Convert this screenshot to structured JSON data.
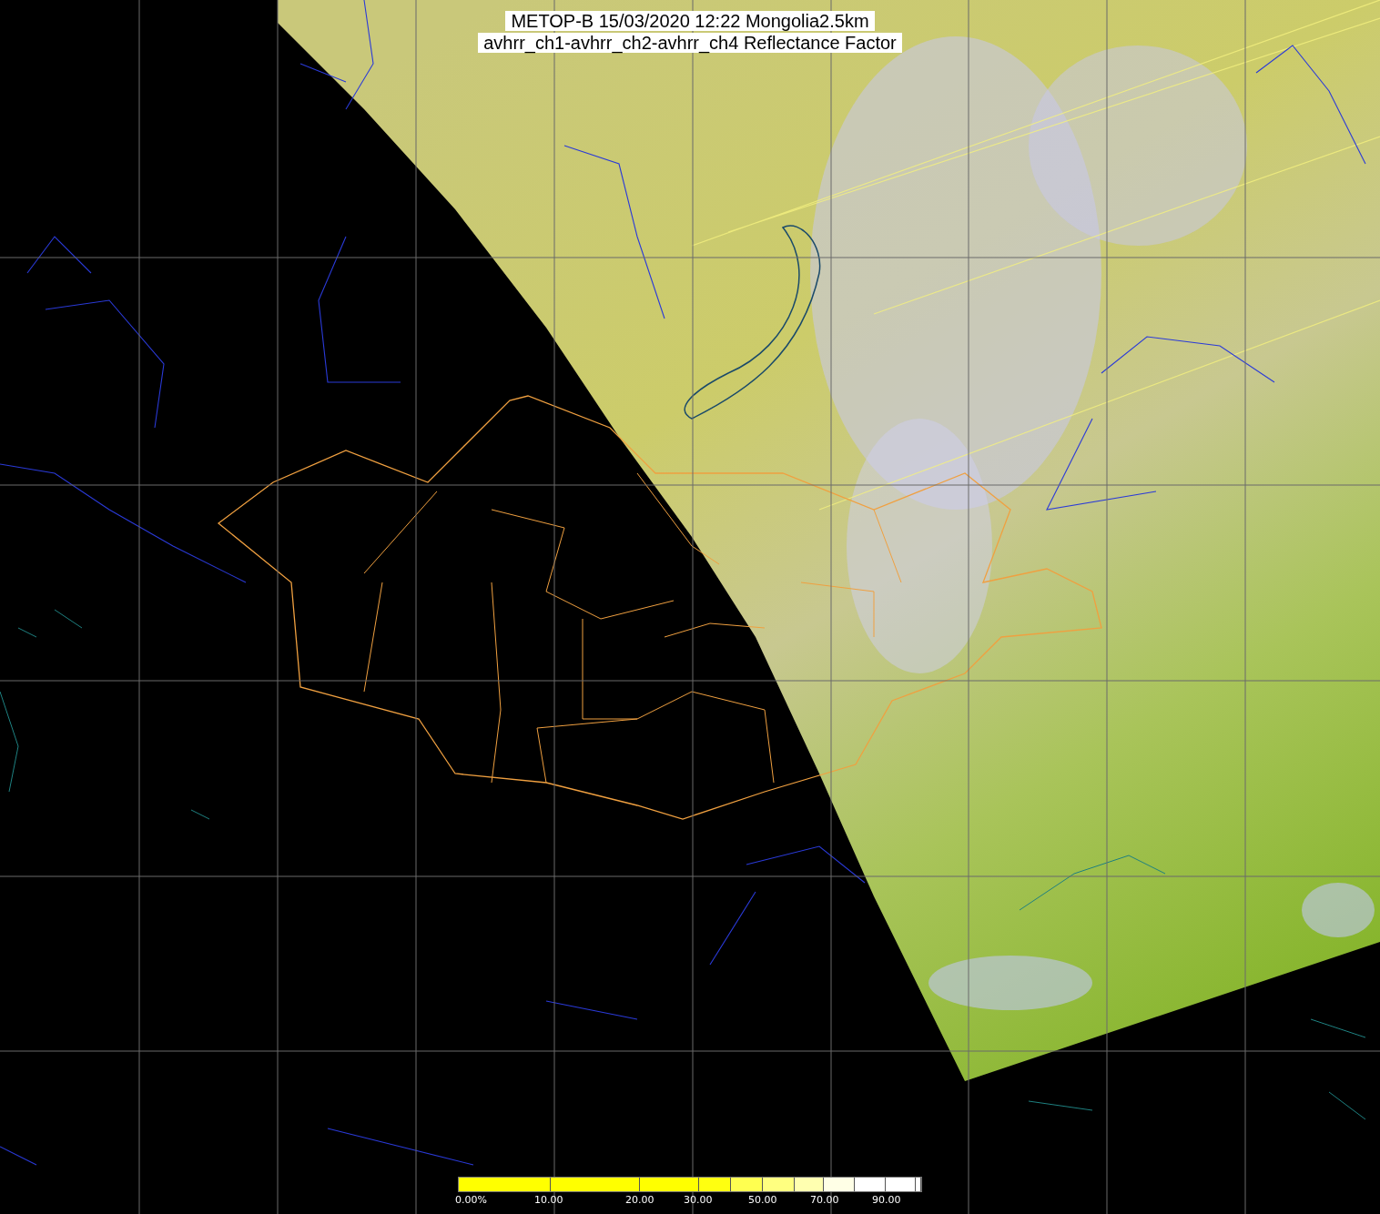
{
  "title_lines": [
    "METOP-B 15/03/2020 12:22 Mongolia2.5km",
    "avhrr_ch1-avhrr_ch2-avhrr_ch4 Reflectance Factor"
  ],
  "colorbar": {
    "segments": [
      {
        "color": "#ffff00"
      },
      {
        "color": "#ffff00"
      },
      {
        "color": "#ffff00"
      },
      {
        "color": "#ffff10"
      },
      {
        "color": "#ffff50"
      },
      {
        "color": "#ffff80"
      },
      {
        "color": "#ffffb0"
      },
      {
        "color": "#ffffe6"
      },
      {
        "color": "#ffffff"
      },
      {
        "color": "#ffffff"
      },
      {
        "color": "#ffffff"
      }
    ],
    "labels": [
      "0.00%",
      "10.00",
      "20.00",
      "30.00",
      "50.00",
      "70.00",
      "90.00"
    ]
  }
}
